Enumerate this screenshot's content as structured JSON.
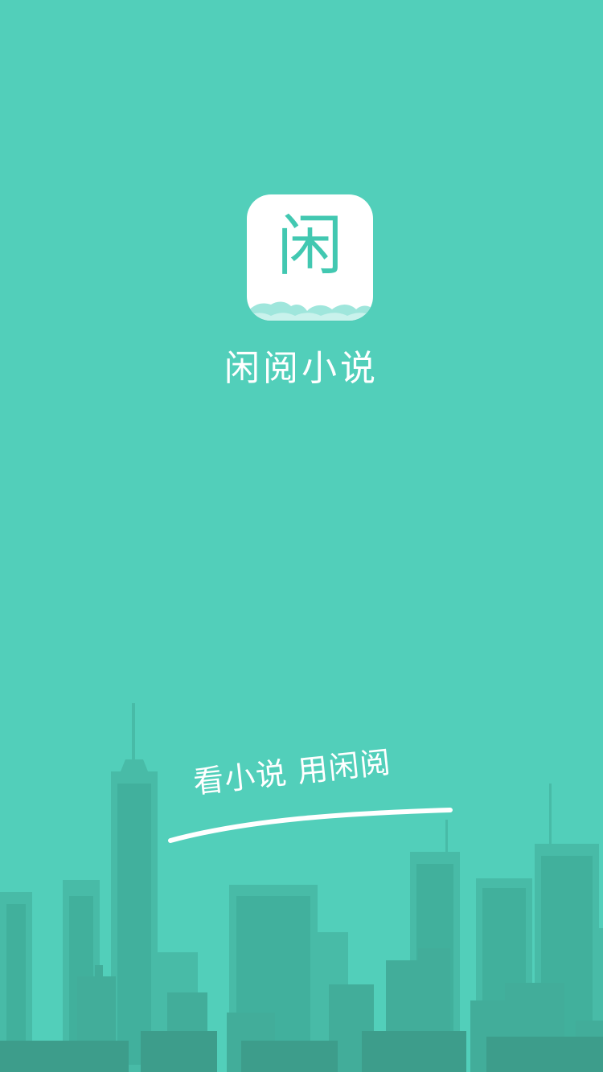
{
  "app": {
    "name": "闲阅小说",
    "logo_char": "闲",
    "tagline": "看小说 用闲阅"
  },
  "colors": {
    "background": "#52cfba",
    "logo_bg": "#ffffff",
    "logo_text": "#42c8b1",
    "city_back": "#48bba7",
    "city_mid": "#42ad9a",
    "city_front": "#3d9d8b"
  },
  "icons": {
    "logo": "app-logo-icon",
    "cloud": "cloud-icon",
    "skyline": "city-skyline-icon"
  }
}
